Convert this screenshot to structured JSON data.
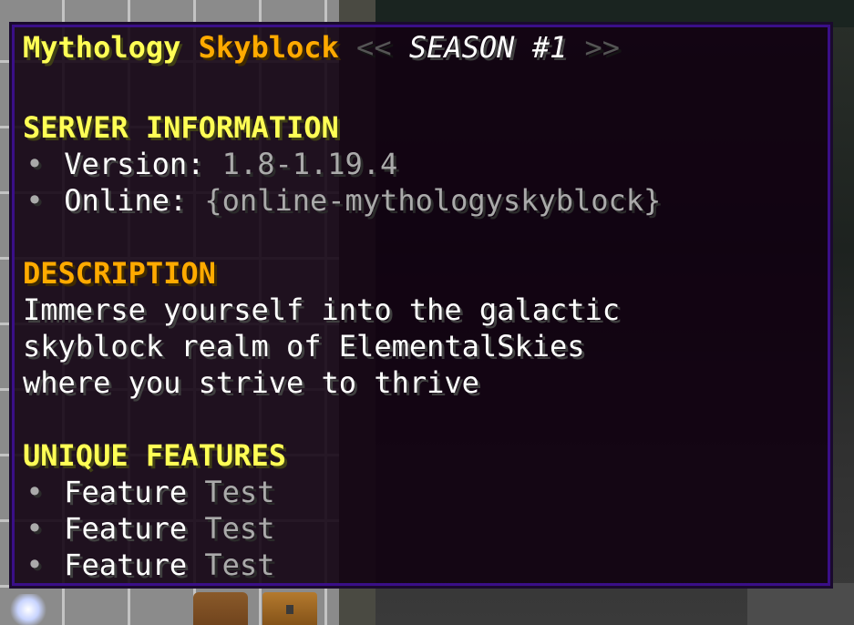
{
  "tooltip": {
    "title": {
      "word1": "Mythology",
      "word2": "Skyblock",
      "open_marks": "<<",
      "season": "SEASON #1",
      "close_marks": ">>"
    },
    "server_info": {
      "heading": "SERVER INFORMATION",
      "bullet": "•",
      "version_label": "Version:",
      "version_value": "1.8-1.19.4",
      "online_label": "Online:",
      "online_value": "{online-mythologyskyblock}"
    },
    "description": {
      "heading": "DESCRIPTION",
      "lines": [
        "Immerse yourself into the galactic",
        "skyblock realm of ElementalSkies",
        "where you strive to thrive"
      ]
    },
    "features": {
      "heading": "UNIQUE FEATURES",
      "items": [
        {
          "word1": "Feature",
          "word2": "Test"
        },
        {
          "word1": "Feature",
          "word2": "Test"
        },
        {
          "word1": "Feature",
          "word2": "Test"
        }
      ]
    }
  },
  "colors": {
    "yellow": "#ffff55",
    "gold": "#ffaa00",
    "gray": "#aaaaaa",
    "dark_gray": "#555555",
    "white": "#ffffff",
    "tooltip_bg": "#100010",
    "tooltip_border": "#3a0f88"
  },
  "hotbar_icons": [
    "nether-star-icon",
    "book-icon",
    "chest-icon"
  ]
}
